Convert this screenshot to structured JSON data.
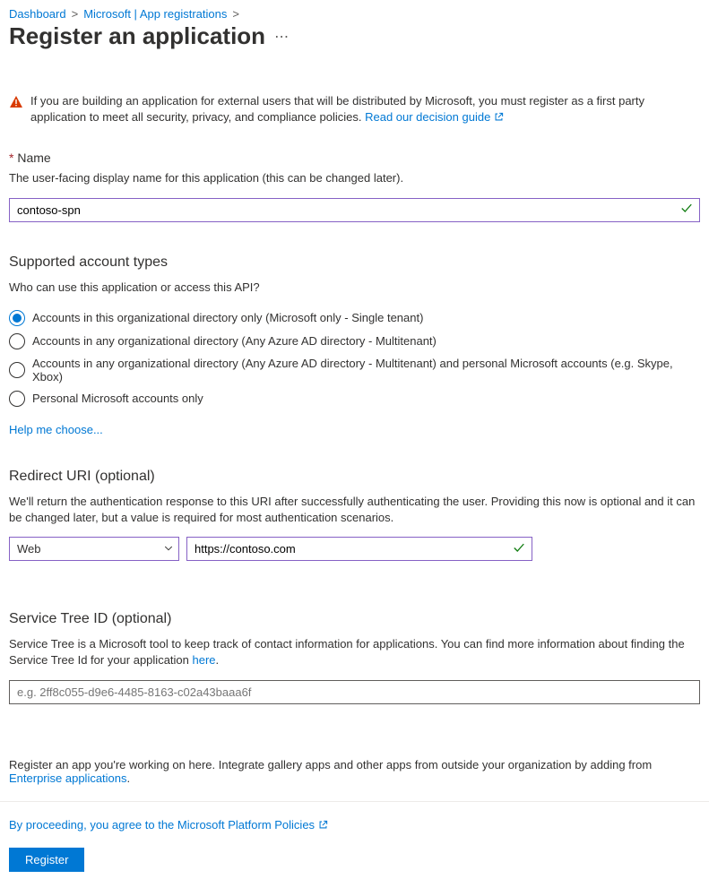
{
  "breadcrumb": {
    "items": [
      "Dashboard",
      "Microsoft | App registrations"
    ]
  },
  "page": {
    "title": "Register an application"
  },
  "warning": {
    "text": "If you are building an application for external users that will be distributed by Microsoft, you must register as a first party application to meet all security, privacy, and compliance policies. ",
    "link": "Read our decision guide"
  },
  "name": {
    "label": "Name",
    "helper": "The user-facing display name for this application (this can be changed later).",
    "value": "contoso-spn"
  },
  "account_types": {
    "title": "Supported account types",
    "helper": "Who can use this application or access this API?",
    "options": [
      "Accounts in this organizational directory only (Microsoft only - Single tenant)",
      "Accounts in any organizational directory (Any Azure AD directory - Multitenant)",
      "Accounts in any organizational directory (Any Azure AD directory - Multitenant) and personal Microsoft accounts (e.g. Skype, Xbox)",
      "Personal Microsoft accounts only"
    ],
    "selected_index": 0,
    "help_link": "Help me choose..."
  },
  "redirect": {
    "title": "Redirect URI (optional)",
    "helper": "We'll return the authentication response to this URI after successfully authenticating the user. Providing this now is optional and it can be changed later, but a value is required for most authentication scenarios.",
    "platform": "Web",
    "uri": "https://contoso.com"
  },
  "service_tree": {
    "title": "Service Tree ID (optional)",
    "helper_pre": "Service Tree is a Microsoft tool to keep track of contact information for applications. You can find more information about finding the Service Tree Id for your application ",
    "helper_link": "here",
    "helper_post": ".",
    "placeholder": "e.g. 2ff8c055-d9e6-4485-8163-c02a43baaa6f"
  },
  "bottom": {
    "text_pre": "Register an app you're working on here. Integrate gallery apps and other apps from outside your organization by adding from ",
    "link": "Enterprise applications",
    "text_post": "."
  },
  "policy": {
    "text": "By proceeding, you agree to the Microsoft Platform Policies"
  },
  "actions": {
    "register": "Register"
  }
}
